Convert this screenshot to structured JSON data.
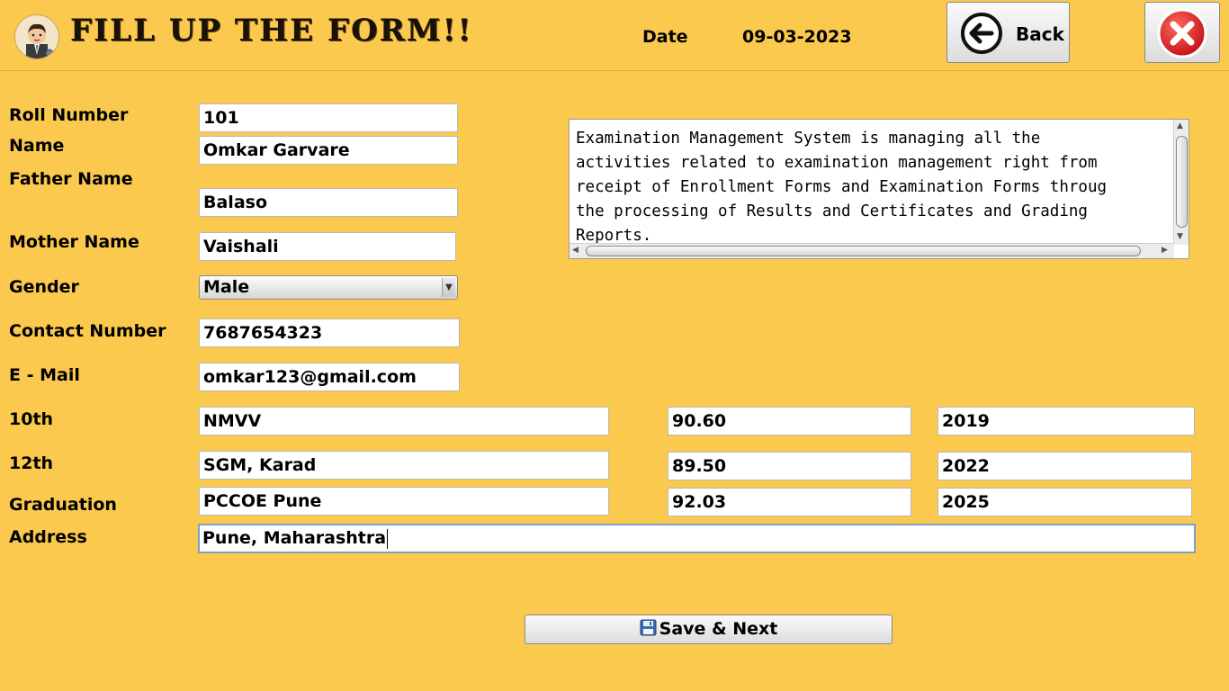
{
  "header": {
    "title": "FILL UP THE FORM!!",
    "date_label": "Date",
    "date_value": "09-03-2023",
    "back_label": "Back"
  },
  "form": {
    "labels": {
      "roll_number": "Roll Number",
      "name": "Name",
      "father_name": "Father Name",
      "mother_name": "Mother Name",
      "gender": "Gender",
      "contact_number": "Contact Number",
      "email": "E - Mail",
      "tenth": "10th",
      "twelfth": "12th",
      "graduation": "Graduation",
      "address": "Address"
    },
    "values": {
      "roll_number": "101",
      "name": "Omkar Garvare",
      "father_name": "Balaso",
      "mother_name": "Vaishali",
      "gender": "Male",
      "contact_number": "7687654323",
      "email": "omkar123@gmail.com",
      "tenth_school": "NMVV",
      "tenth_percent": "90.60",
      "tenth_year": "2019",
      "twelfth_school": "SGM, Karad",
      "twelfth_percent": "89.50",
      "twelfth_year": "2022",
      "graduation_college": "PCCOE Pune",
      "graduation_percent": "92.03",
      "graduation_year": "2025",
      "address": "Pune, Maharashtra"
    }
  },
  "description": "Examination Management System is managing all the\nactivities related to examination management right from\nreceipt of Enrollment Forms and Examination Forms throug\nthe processing of Results and Certificates and Grading\nReports.",
  "save_label": "Save & Next",
  "colors": {
    "background": "#FBC94E",
    "close_red": "#E5262B"
  },
  "icons": {
    "avatar": "user-avatar-icon",
    "back": "back-arrow-icon",
    "close": "close-icon",
    "save": "floppy-disk-icon"
  }
}
